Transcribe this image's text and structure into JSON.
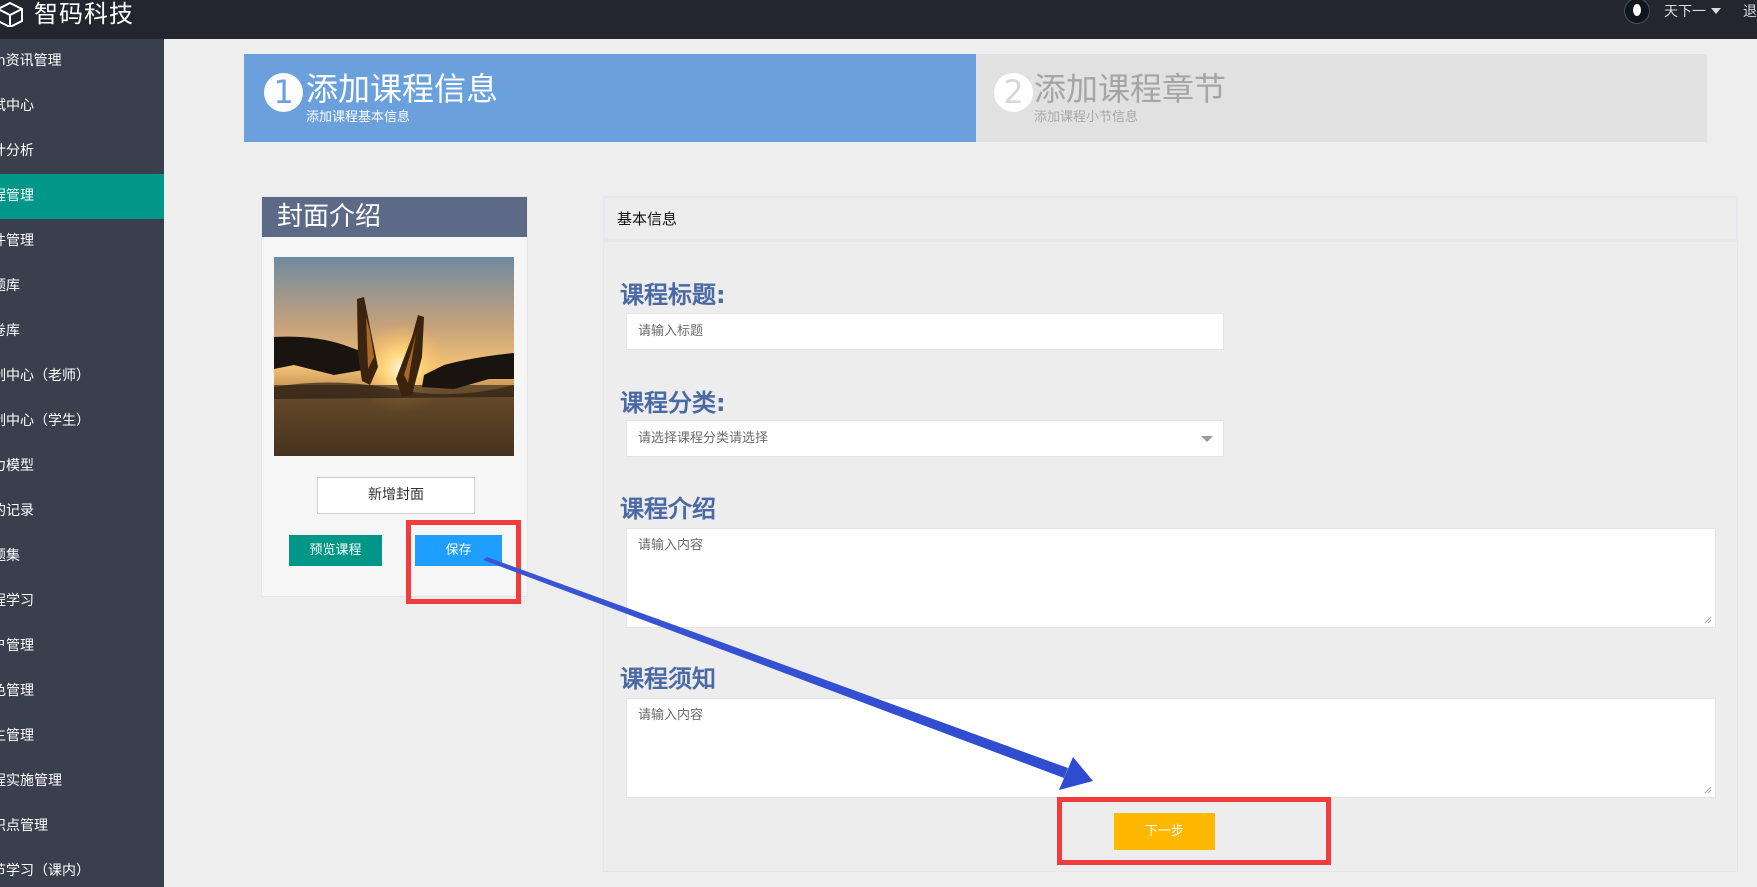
{
  "header": {
    "app_name": "智码科技",
    "user_name": "天下一",
    "logout_label": "退"
  },
  "sidebar": {
    "items": [
      {
        "label": "m资讯管理"
      },
      {
        "label": "试中心"
      },
      {
        "label": "计分析"
      },
      {
        "label": "程管理"
      },
      {
        "label": "件管理"
      },
      {
        "label": "题库"
      },
      {
        "label": "卷库"
      },
      {
        "label": "制中心（老师）"
      },
      {
        "label": "制中心（学生）"
      },
      {
        "label": "力模型"
      },
      {
        "label": "的记录"
      },
      {
        "label": "题集"
      },
      {
        "label": "程学习"
      },
      {
        "label": "户管理"
      },
      {
        "label": "色管理"
      },
      {
        "label": "生管理"
      },
      {
        "label": "程实施管理"
      },
      {
        "label": "识点管理"
      },
      {
        "label": "节学习（课内）"
      }
    ],
    "active_index": 3
  },
  "steps": [
    {
      "number": "1",
      "title": "添加课程信息",
      "subtitle": "添加课程基本信息",
      "active": true
    },
    {
      "number": "2",
      "title": "添加课程章节",
      "subtitle": "添加课程小节信息",
      "active": false
    }
  ],
  "cover": {
    "heading": "封面介绍",
    "add_cover_label": "新增封面",
    "preview_label": "预览课程",
    "save_label": "保存"
  },
  "form": {
    "panel_title": "基本信息",
    "title_label": "课程标题:",
    "title_placeholder": "请输入标题",
    "category_label": "课程分类:",
    "category_placeholder": "请选择课程分类请选择",
    "intro_label": "课程介绍",
    "intro_placeholder": "请输入内容",
    "notice_label": "课程须知",
    "notice_placeholder": "请输入内容",
    "next_label": "下一步"
  },
  "colors": {
    "topbar": "#23262e",
    "sidebar": "#3a3f4e",
    "sidebar_active": "#009688",
    "step_active": "#6aa1dc",
    "step_inactive": "#e1e1e1",
    "label_blue": "#4b6aa5",
    "save_button": "#1e9fff",
    "preview_button": "#009688",
    "next_button": "#ffb800",
    "annotation_red": "#f03c3c",
    "annotation_arrow": "#3b55d4"
  }
}
